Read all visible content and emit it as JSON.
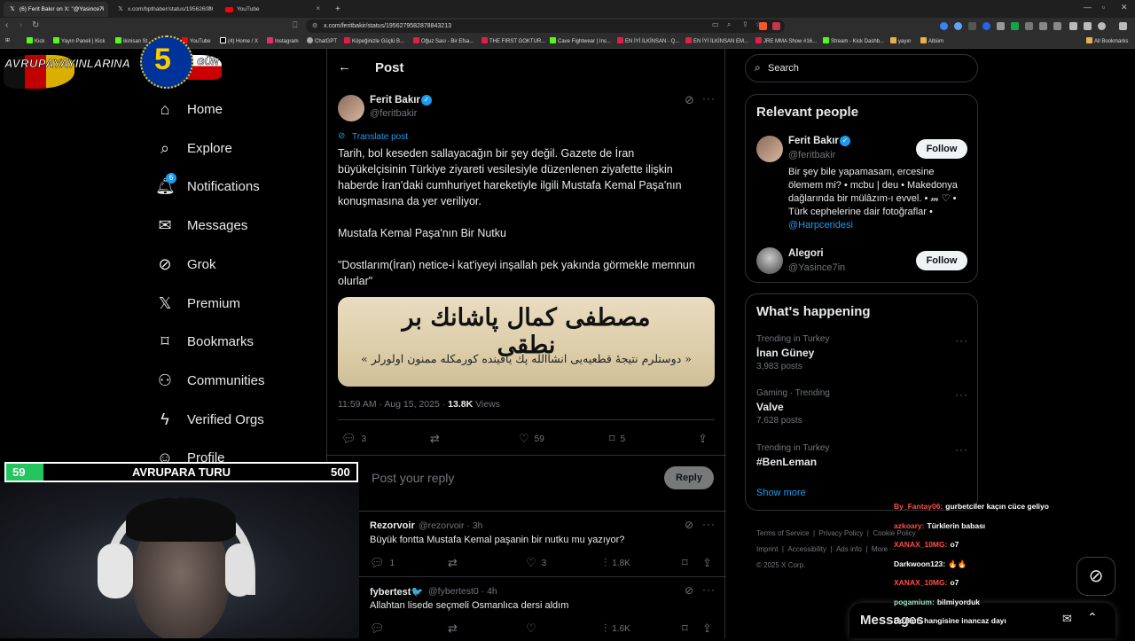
{
  "browser": {
    "tabs": [
      {
        "label": "(6) Ferit Bakır on X: \"@Yasince7i"
      },
      {
        "label": "x.com/bpthaber/status/1956260369"
      },
      {
        "label": "YouTube"
      }
    ],
    "url": "x.com/feritbakir/status/1956279582878843213",
    "bookmarks": [
      "Kick",
      "Yayın Paneli | Kick",
      "ikinisan St",
      "YouTube",
      "(4) Home / X",
      "Instagram",
      "ChatGPT",
      "Köpeğinizle Güçlü B...",
      "Oğuz Sası - Bir Efsa...",
      "THE FIRST GOKTUR...",
      "Cave Fightwear | Ins...",
      "EN İYİ İLKİNSAN - Q...",
      "EN İYİ İLKİNSAN EM...",
      "JRE MMA Show #16...",
      "Stream - Kick Dashb...",
      "yayın",
      "Albüm",
      "All Bookmarks"
    ]
  },
  "logo_overlay": {
    "left_text": "AVRUPA",
    "mid_text": "YAYINLARINA",
    "number": "5",
    "right_text": "GÜN"
  },
  "sidebar": {
    "items": [
      {
        "label": "Home",
        "icon": "home-icon"
      },
      {
        "label": "Explore",
        "icon": "search-icon"
      },
      {
        "label": "Notifications",
        "icon": "bell-icon",
        "badge": "6"
      },
      {
        "label": "Messages",
        "icon": "mail-icon"
      },
      {
        "label": "Grok",
        "icon": "grok-icon"
      },
      {
        "label": "Premium",
        "icon": "x-logo-icon"
      },
      {
        "label": "Bookmarks",
        "icon": "bookmark-icon"
      },
      {
        "label": "Communities",
        "icon": "communities-icon"
      },
      {
        "label": "Verified Orgs",
        "icon": "bolt-icon"
      },
      {
        "label": "Profile",
        "icon": "profile-icon"
      }
    ]
  },
  "post": {
    "header": "Post",
    "author_name": "Ferit Bakır",
    "author_handle": "@feritbakir",
    "translate": "Translate post",
    "paragraph1": "Tarih, bol keseden sallayacağın bir şey değil. Gazete de İran büyükelçisinin Türkiye ziyareti vesilesiyle düzenlenen ziyafette ilişkin haberde İran'daki cumhuriyet hareketiyle ilgili Mustafa Kemal Paşa'nın konuşmasına da yer veriliyor.",
    "paragraph2": "Mustafa Kemal Paşa'nın Bir Nutku",
    "paragraph3": "\"Dostlarım(İran) netice-i kat'iyeyi inşallah pek yakında görmekle memnun olurlar\"",
    "image_line1": "مصطفى كمال پاشانك بر نطقى",
    "image_line2": "« دوستلرم نتيجهٔ قطعيه‌يى انشاالله پك ياقينده كورمكله ممنون اولورلر »",
    "timestamp": "11:59 AM · Aug 15, 2025 · ",
    "views_count": "13.8K",
    "views_label": " Views",
    "replies": "3",
    "likes": "59",
    "bookmarks": "5",
    "reply_placeholder": "Post your reply",
    "reply_button": "Reply"
  },
  "replies": [
    {
      "name": "Rezorvoir",
      "handle": "@rezorvoir · 3h",
      "text": "Büyük fontta Mustafa Kemal paşanin bir nutku mu yazıyor?",
      "replies": "1",
      "retweets": "",
      "likes": "3",
      "views": "1.8K"
    },
    {
      "name": "fybertest🐦",
      "handle": "@fybertest0 · 4h",
      "text": "Allahtan lisede seçmeli Osmanlıca dersi aldım",
      "replies": "",
      "retweets": "",
      "likes": "",
      "views": "1.6K"
    }
  ],
  "right": {
    "search_placeholder": "Search",
    "relevant_title": "Relevant people",
    "people": [
      {
        "name": "Ferit Bakır",
        "handle": "@feritbakir",
        "bio": "Bir şey bile yapamasam, ercesine ölemem mi? • mcbu | deu • Makedonya dağlarında bir mülâzım-ı evvel. • 𝓂 ♡ • Türk cephelerine dair fotoğraflar • ",
        "bio_link": "@Harpceridesi",
        "button": "Follow"
      },
      {
        "name": "Alegori",
        "handle": "@Yasince7in",
        "button": "Follow"
      }
    ],
    "happening_title": "What's happening",
    "trends": [
      {
        "label": "Trending in Turkey",
        "name": "İnan Güney",
        "posts": "3,983 posts"
      },
      {
        "label": "Gaming · Trending",
        "name": "Valve",
        "posts": "7,628 posts"
      },
      {
        "label": "Trending in Turkey",
        "name": "#BenLeman",
        "posts": ""
      }
    ],
    "show_more": "Show more",
    "footer": [
      "Terms of Service",
      "Privacy Policy",
      "Cookie Policy",
      "Imprint",
      "Accessibility",
      "Ads info",
      "More ···",
      "© 2025 X Corp."
    ],
    "messages_label": "Messages"
  },
  "stream_banner": {
    "left": "59",
    "center": "AVRUPARA TURU",
    "right": "500"
  },
  "chat": [
    {
      "user": "By_Fantay06:",
      "color": "#ff4d4d",
      "text": "gurbetciler kaçın cüce geliyo"
    },
    {
      "user": "azkoary:",
      "color": "#ff4d4d",
      "text": "Türklerin babası"
    },
    {
      "user": "XANAX_10MG:",
      "color": "#ff4d4d",
      "text": "o7"
    },
    {
      "user": "Darkwoon123:",
      "color": "#ffffff",
      "text": "🔥🔥"
    },
    {
      "user": "XANAX_10MG:",
      "color": "#ff4d4d",
      "text": "o7"
    },
    {
      "user": "pogamium:",
      "color": "#9ae6c4",
      "text": "bilmiyorduk"
    },
    {
      "user": "Bozkut:",
      "color": "#ffffff",
      "text": "hangisine inancaz dayı"
    }
  ]
}
